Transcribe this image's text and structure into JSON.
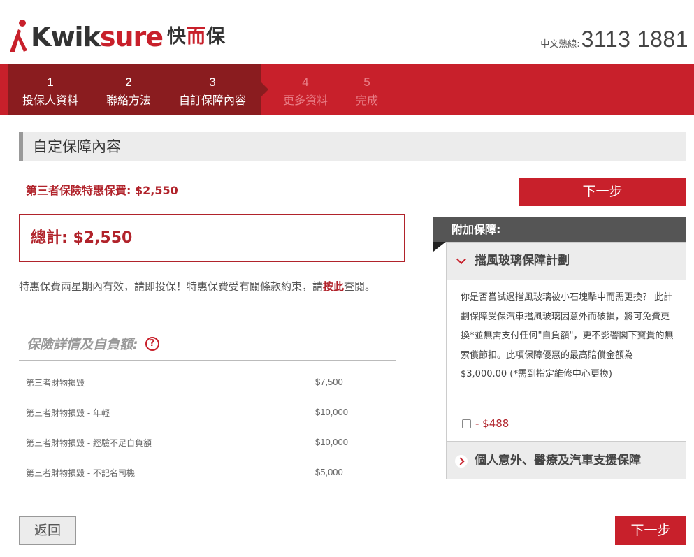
{
  "header": {
    "logo_en_dark": "Kwik",
    "logo_en_red": "sure",
    "logo_cn_1": "快",
    "logo_cn_2": "而",
    "logo_cn_3": "保",
    "hotline_label": "中文熱線:",
    "hotline_number": "3113 1881"
  },
  "steps": [
    {
      "num": "1",
      "label": "投保人資料",
      "state": "done"
    },
    {
      "num": "2",
      "label": "聯絡方法",
      "state": "done"
    },
    {
      "num": "3",
      "label": "自訂保障內容",
      "state": "current"
    },
    {
      "num": "4",
      "label": "更多資料",
      "state": "upcoming"
    },
    {
      "num": "5",
      "label": "完成",
      "state": "upcoming"
    }
  ],
  "section_title": "自定保障內容",
  "special_premium": "第三者保險特惠保費: $2,550",
  "next_label": "下一步",
  "total": "總計: $2,550",
  "validity": {
    "text_before": "特惠保費兩星期內有效，請即投保！特惠保費受有關條款約束，請",
    "link": "按此",
    "text_after": "查閱。"
  },
  "details": {
    "heading": "保險詳情及自負額:",
    "help_icon_glyph": "?",
    "rows": [
      {
        "label": "第三者財物損毀",
        "value": "$7,500"
      },
      {
        "label": "第三者財物損毀 - 年輕",
        "value": "$10,000"
      },
      {
        "label": "第三者財物損毀 - 經驗不足自負額",
        "value": "$10,000"
      },
      {
        "label": "第三者財物損毀 - 不記名司機",
        "value": "$5,000"
      }
    ]
  },
  "addon": {
    "header": "附加保障:",
    "windscreen": {
      "title": "擋風玻璃保障計劃",
      "description": "你是否嘗試過擋風玻璃被小石塊擊中而需更換？ 此計劃保障受保汽車擋風玻璃因意外而破損，將可免費更換*並無需支付任何\"自負額\"，更不影響閣下寶貴的無索償節扣。此項保障優惠的最高賠償金額為$3,000.00 (*需到指定維修中心更換)",
      "price": "- $488",
      "checked": false
    },
    "personal": {
      "title": "個人意外、醫療及汽車支援保障"
    }
  },
  "back_label": "返回",
  "colors": {
    "brand_red": "#c8202b",
    "dark_red": "#8a1c1f",
    "text_red": "#b1232b"
  }
}
